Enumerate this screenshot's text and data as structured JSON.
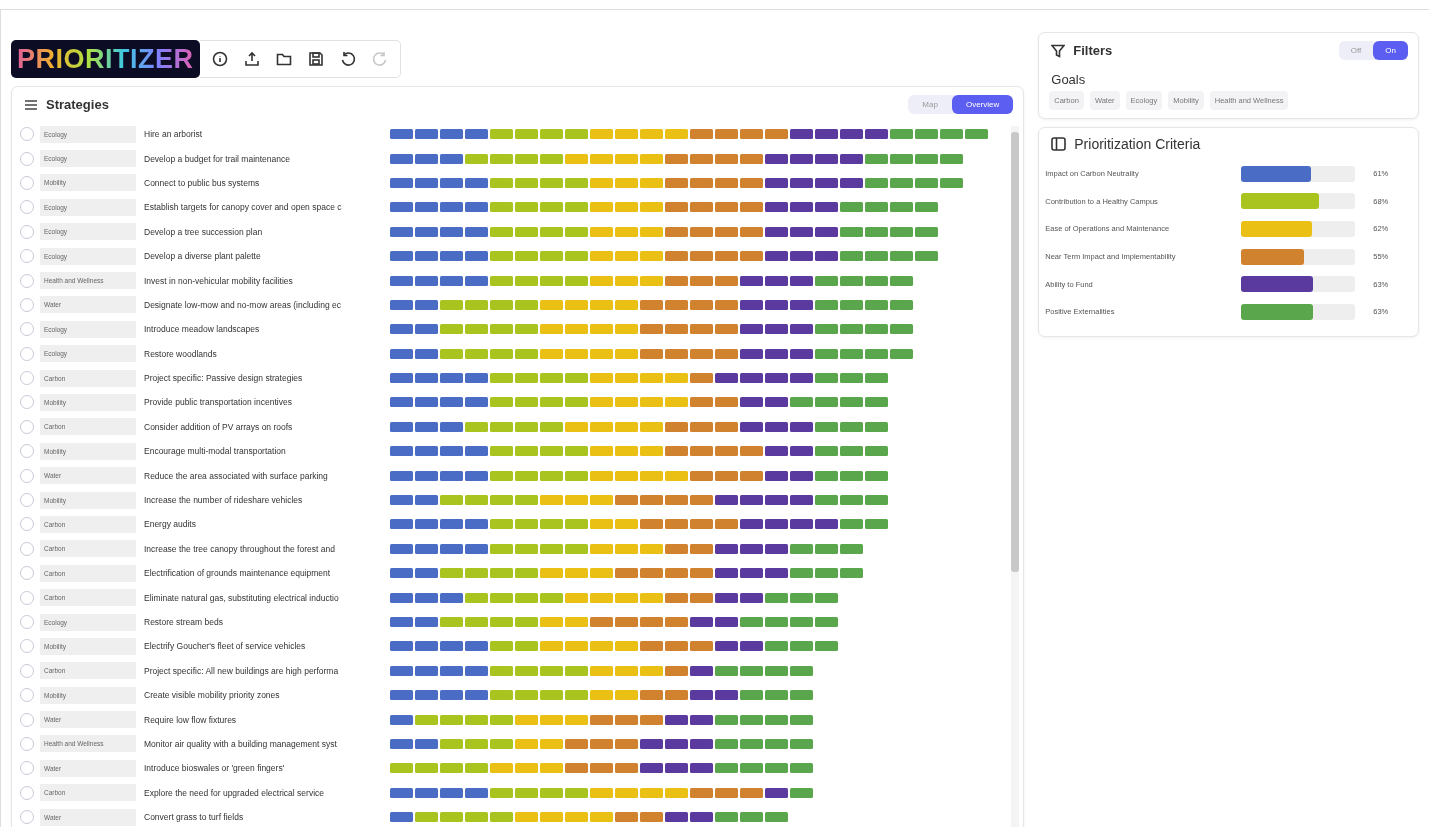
{
  "app": {
    "logo": "PRIORITIZER"
  },
  "toolbar": [
    {
      "kind": "info",
      "disabled": false
    },
    {
      "kind": "upload",
      "disabled": false
    },
    {
      "kind": "folder",
      "disabled": false
    },
    {
      "kind": "save",
      "disabled": false
    },
    {
      "kind": "undo",
      "disabled": false
    },
    {
      "kind": "redo",
      "disabled": true
    }
  ],
  "strategies": {
    "title": "Strategies",
    "views": [
      {
        "label": "Map",
        "selected": false
      },
      {
        "label": "Overview",
        "selected": true
      }
    ],
    "rows": [
      {
        "goal": "Ecology",
        "name": "Hire an arborist",
        "selected": false,
        "blocks": [
          {
            "color": "#4a6cc4"
          },
          {
            "color": "#4a6cc4"
          },
          {
            "color": "#4a6cc4"
          },
          {
            "color": "#4a6cc4"
          },
          {
            "color": "#a9c41f"
          },
          {
            "color": "#a9c41f"
          },
          {
            "color": "#a9c41f"
          },
          {
            "color": "#a9c41f"
          },
          {
            "color": "#e9c013"
          },
          {
            "color": "#e9c013"
          },
          {
            "color": "#e9c013"
          },
          {
            "color": "#e9c013"
          },
          {
            "color": "#d0822f"
          },
          {
            "color": "#d0822f"
          },
          {
            "color": "#d0822f"
          },
          {
            "color": "#d0822f"
          },
          {
            "color": "#5a3a9f"
          },
          {
            "color": "#5a3a9f"
          },
          {
            "color": "#5a3a9f"
          },
          {
            "color": "#5a3a9f"
          },
          {
            "color": "#5aa64c"
          },
          {
            "color": "#5aa64c"
          },
          {
            "color": "#5aa64c"
          },
          {
            "color": "#5aa64c"
          }
        ]
      },
      {
        "goal": "Ecology",
        "name": "Develop a budget for trail maintenance",
        "selected": false,
        "blocks": [
          {
            "color": "#4a6cc4"
          },
          {
            "color": "#4a6cc4"
          },
          {
            "color": "#4a6cc4"
          },
          {
            "color": "#a9c41f"
          },
          {
            "color": "#a9c41f"
          },
          {
            "color": "#a9c41f"
          },
          {
            "color": "#a9c41f"
          },
          {
            "color": "#e9c013"
          },
          {
            "color": "#e9c013"
          },
          {
            "color": "#e9c013"
          },
          {
            "color": "#e9c013"
          },
          {
            "color": "#d0822f"
          },
          {
            "color": "#d0822f"
          },
          {
            "color": "#d0822f"
          },
          {
            "color": "#d0822f"
          },
          {
            "color": "#5a3a9f"
          },
          {
            "color": "#5a3a9f"
          },
          {
            "color": "#5a3a9f"
          },
          {
            "color": "#5a3a9f"
          },
          {
            "color": "#5aa64c"
          },
          {
            "color": "#5aa64c"
          },
          {
            "color": "#5aa64c"
          },
          {
            "color": "#5aa64c"
          }
        ]
      },
      {
        "goal": "Mobility",
        "name": "Connect to public bus systems",
        "selected": false,
        "blocks": [
          {
            "color": "#4a6cc4"
          },
          {
            "color": "#4a6cc4"
          },
          {
            "color": "#4a6cc4"
          },
          {
            "color": "#4a6cc4"
          },
          {
            "color": "#a9c41f"
          },
          {
            "color": "#a9c41f"
          },
          {
            "color": "#a9c41f"
          },
          {
            "color": "#a9c41f"
          },
          {
            "color": "#e9c013"
          },
          {
            "color": "#e9c013"
          },
          {
            "color": "#e9c013"
          },
          {
            "color": "#d0822f"
          },
          {
            "color": "#d0822f"
          },
          {
            "color": "#d0822f"
          },
          {
            "color": "#d0822f"
          },
          {
            "color": "#5a3a9f"
          },
          {
            "color": "#5a3a9f"
          },
          {
            "color": "#5a3a9f"
          },
          {
            "color": "#5a3a9f"
          },
          {
            "color": "#5aa64c"
          },
          {
            "color": "#5aa64c"
          },
          {
            "color": "#5aa64c"
          },
          {
            "color": "#5aa64c"
          }
        ]
      },
      {
        "goal": "Ecology",
        "name": "Establish targets for canopy cover and open space c",
        "selected": false,
        "blocks": [
          {
            "color": "#4a6cc4"
          },
          {
            "color": "#4a6cc4"
          },
          {
            "color": "#4a6cc4"
          },
          {
            "color": "#4a6cc4"
          },
          {
            "color": "#a9c41f"
          },
          {
            "color": "#a9c41f"
          },
          {
            "color": "#a9c41f"
          },
          {
            "color": "#a9c41f"
          },
          {
            "color": "#e9c013"
          },
          {
            "color": "#e9c013"
          },
          {
            "color": "#e9c013"
          },
          {
            "color": "#d0822f"
          },
          {
            "color": "#d0822f"
          },
          {
            "color": "#d0822f"
          },
          {
            "color": "#d0822f"
          },
          {
            "color": "#5a3a9f"
          },
          {
            "color": "#5a3a9f"
          },
          {
            "color": "#5a3a9f"
          },
          {
            "color": "#5aa64c"
          },
          {
            "color": "#5aa64c"
          },
          {
            "color": "#5aa64c"
          },
          {
            "color": "#5aa64c"
          }
        ]
      },
      {
        "goal": "Ecology",
        "name": "Develop a tree succession plan",
        "selected": false,
        "blocks": [
          {
            "color": "#4a6cc4"
          },
          {
            "color": "#4a6cc4"
          },
          {
            "color": "#4a6cc4"
          },
          {
            "color": "#4a6cc4"
          },
          {
            "color": "#a9c41f"
          },
          {
            "color": "#a9c41f"
          },
          {
            "color": "#a9c41f"
          },
          {
            "color": "#a9c41f"
          },
          {
            "color": "#e9c013"
          },
          {
            "color": "#e9c013"
          },
          {
            "color": "#e9c013"
          },
          {
            "color": "#d0822f"
          },
          {
            "color": "#d0822f"
          },
          {
            "color": "#d0822f"
          },
          {
            "color": "#d0822f"
          },
          {
            "color": "#5a3a9f"
          },
          {
            "color": "#5a3a9f"
          },
          {
            "color": "#5a3a9f"
          },
          {
            "color": "#5aa64c"
          },
          {
            "color": "#5aa64c"
          },
          {
            "color": "#5aa64c"
          },
          {
            "color": "#5aa64c"
          }
        ]
      },
      {
        "goal": "Ecology",
        "name": "Develop a diverse plant palette",
        "selected": false,
        "blocks": [
          {
            "color": "#4a6cc4"
          },
          {
            "color": "#4a6cc4"
          },
          {
            "color": "#4a6cc4"
          },
          {
            "color": "#4a6cc4"
          },
          {
            "color": "#a9c41f"
          },
          {
            "color": "#a9c41f"
          },
          {
            "color": "#a9c41f"
          },
          {
            "color": "#a9c41f"
          },
          {
            "color": "#e9c013"
          },
          {
            "color": "#e9c013"
          },
          {
            "color": "#e9c013"
          },
          {
            "color": "#d0822f"
          },
          {
            "color": "#d0822f"
          },
          {
            "color": "#d0822f"
          },
          {
            "color": "#d0822f"
          },
          {
            "color": "#5a3a9f"
          },
          {
            "color": "#5a3a9f"
          },
          {
            "color": "#5a3a9f"
          },
          {
            "color": "#5aa64c"
          },
          {
            "color": "#5aa64c"
          },
          {
            "color": "#5aa64c"
          },
          {
            "color": "#5aa64c"
          }
        ]
      },
      {
        "goal": "Health and Wellness",
        "name": "Invest in non-vehicular mobility facilities",
        "selected": false,
        "blocks": [
          {
            "color": "#4a6cc4"
          },
          {
            "color": "#4a6cc4"
          },
          {
            "color": "#4a6cc4"
          },
          {
            "color": "#4a6cc4"
          },
          {
            "color": "#a9c41f"
          },
          {
            "color": "#a9c41f"
          },
          {
            "color": "#a9c41f"
          },
          {
            "color": "#a9c41f"
          },
          {
            "color": "#e9c013"
          },
          {
            "color": "#e9c013"
          },
          {
            "color": "#e9c013"
          },
          {
            "color": "#d0822f"
          },
          {
            "color": "#d0822f"
          },
          {
            "color": "#d0822f"
          },
          {
            "color": "#5a3a9f"
          },
          {
            "color": "#5a3a9f"
          },
          {
            "color": "#5a3a9f"
          },
          {
            "color": "#5aa64c"
          },
          {
            "color": "#5aa64c"
          },
          {
            "color": "#5aa64c"
          },
          {
            "color": "#5aa64c"
          }
        ]
      },
      {
        "goal": "Water",
        "name": "Designate low-mow and no-mow areas (including ec",
        "selected": false,
        "blocks": [
          {
            "color": "#4a6cc4"
          },
          {
            "color": "#4a6cc4"
          },
          {
            "color": "#a9c41f"
          },
          {
            "color": "#a9c41f"
          },
          {
            "color": "#a9c41f"
          },
          {
            "color": "#a9c41f"
          },
          {
            "color": "#e9c013"
          },
          {
            "color": "#e9c013"
          },
          {
            "color": "#e9c013"
          },
          {
            "color": "#e9c013"
          },
          {
            "color": "#d0822f"
          },
          {
            "color": "#d0822f"
          },
          {
            "color": "#d0822f"
          },
          {
            "color": "#d0822f"
          },
          {
            "color": "#5a3a9f"
          },
          {
            "color": "#5a3a9f"
          },
          {
            "color": "#5a3a9f"
          },
          {
            "color": "#5aa64c"
          },
          {
            "color": "#5aa64c"
          },
          {
            "color": "#5aa64c"
          },
          {
            "color": "#5aa64c"
          }
        ]
      },
      {
        "goal": "Ecology",
        "name": "Introduce meadow landscapes",
        "selected": false,
        "blocks": [
          {
            "color": "#4a6cc4"
          },
          {
            "color": "#4a6cc4"
          },
          {
            "color": "#a9c41f"
          },
          {
            "color": "#a9c41f"
          },
          {
            "color": "#a9c41f"
          },
          {
            "color": "#a9c41f"
          },
          {
            "color": "#e9c013"
          },
          {
            "color": "#e9c013"
          },
          {
            "color": "#e9c013"
          },
          {
            "color": "#e9c013"
          },
          {
            "color": "#d0822f"
          },
          {
            "color": "#d0822f"
          },
          {
            "color": "#d0822f"
          },
          {
            "color": "#d0822f"
          },
          {
            "color": "#5a3a9f"
          },
          {
            "color": "#5a3a9f"
          },
          {
            "color": "#5a3a9f"
          },
          {
            "color": "#5aa64c"
          },
          {
            "color": "#5aa64c"
          },
          {
            "color": "#5aa64c"
          },
          {
            "color": "#5aa64c"
          }
        ]
      },
      {
        "goal": "Ecology",
        "name": "Restore woodlands",
        "selected": false,
        "blocks": [
          {
            "color": "#4a6cc4"
          },
          {
            "color": "#4a6cc4"
          },
          {
            "color": "#a9c41f"
          },
          {
            "color": "#a9c41f"
          },
          {
            "color": "#a9c41f"
          },
          {
            "color": "#a9c41f"
          },
          {
            "color": "#e9c013"
          },
          {
            "color": "#e9c013"
          },
          {
            "color": "#e9c013"
          },
          {
            "color": "#e9c013"
          },
          {
            "color": "#d0822f"
          },
          {
            "color": "#d0822f"
          },
          {
            "color": "#d0822f"
          },
          {
            "color": "#d0822f"
          },
          {
            "color": "#5a3a9f"
          },
          {
            "color": "#5a3a9f"
          },
          {
            "color": "#5a3a9f"
          },
          {
            "color": "#5aa64c"
          },
          {
            "color": "#5aa64c"
          },
          {
            "color": "#5aa64c"
          },
          {
            "color": "#5aa64c"
          }
        ]
      },
      {
        "goal": "Carbon",
        "name": "Project specific: Passive design strategies",
        "selected": false,
        "blocks": [
          {
            "color": "#4a6cc4"
          },
          {
            "color": "#4a6cc4"
          },
          {
            "color": "#4a6cc4"
          },
          {
            "color": "#4a6cc4"
          },
          {
            "color": "#a9c41f"
          },
          {
            "color": "#a9c41f"
          },
          {
            "color": "#a9c41f"
          },
          {
            "color": "#a9c41f"
          },
          {
            "color": "#e9c013"
          },
          {
            "color": "#e9c013"
          },
          {
            "color": "#e9c013"
          },
          {
            "color": "#e9c013"
          },
          {
            "color": "#d0822f"
          },
          {
            "color": "#5a3a9f"
          },
          {
            "color": "#5a3a9f"
          },
          {
            "color": "#5a3a9f"
          },
          {
            "color": "#5a3a9f"
          },
          {
            "color": "#5aa64c"
          },
          {
            "color": "#5aa64c"
          },
          {
            "color": "#5aa64c"
          }
        ]
      },
      {
        "goal": "Mobility",
        "name": "Provide public transportation incentives",
        "selected": false,
        "blocks": [
          {
            "color": "#4a6cc4"
          },
          {
            "color": "#4a6cc4"
          },
          {
            "color": "#4a6cc4"
          },
          {
            "color": "#4a6cc4"
          },
          {
            "color": "#a9c41f"
          },
          {
            "color": "#a9c41f"
          },
          {
            "color": "#a9c41f"
          },
          {
            "color": "#a9c41f"
          },
          {
            "color": "#e9c013"
          },
          {
            "color": "#e9c013"
          },
          {
            "color": "#e9c013"
          },
          {
            "color": "#e9c013"
          },
          {
            "color": "#d0822f"
          },
          {
            "color": "#d0822f"
          },
          {
            "color": "#5a3a9f"
          },
          {
            "color": "#5a3a9f"
          },
          {
            "color": "#5aa64c"
          },
          {
            "color": "#5aa64c"
          },
          {
            "color": "#5aa64c"
          },
          {
            "color": "#5aa64c"
          }
        ]
      },
      {
        "goal": "Carbon",
        "name": "Consider addition of PV arrays on roofs",
        "selected": false,
        "blocks": [
          {
            "color": "#4a6cc4"
          },
          {
            "color": "#4a6cc4"
          },
          {
            "color": "#4a6cc4"
          },
          {
            "color": "#a9c41f"
          },
          {
            "color": "#a9c41f"
          },
          {
            "color": "#a9c41f"
          },
          {
            "color": "#a9c41f"
          },
          {
            "color": "#e9c013"
          },
          {
            "color": "#e9c013"
          },
          {
            "color": "#e9c013"
          },
          {
            "color": "#e9c013"
          },
          {
            "color": "#d0822f"
          },
          {
            "color": "#d0822f"
          },
          {
            "color": "#d0822f"
          },
          {
            "color": "#5a3a9f"
          },
          {
            "color": "#5a3a9f"
          },
          {
            "color": "#5a3a9f"
          },
          {
            "color": "#5aa64c"
          },
          {
            "color": "#5aa64c"
          },
          {
            "color": "#5aa64c"
          }
        ]
      },
      {
        "goal": "Mobility",
        "name": "Encourage multi-modal transportation",
        "selected": false,
        "blocks": [
          {
            "color": "#4a6cc4"
          },
          {
            "color": "#4a6cc4"
          },
          {
            "color": "#4a6cc4"
          },
          {
            "color": "#4a6cc4"
          },
          {
            "color": "#a9c41f"
          },
          {
            "color": "#a9c41f"
          },
          {
            "color": "#a9c41f"
          },
          {
            "color": "#a9c41f"
          },
          {
            "color": "#e9c013"
          },
          {
            "color": "#e9c013"
          },
          {
            "color": "#e9c013"
          },
          {
            "color": "#d0822f"
          },
          {
            "color": "#d0822f"
          },
          {
            "color": "#d0822f"
          },
          {
            "color": "#d0822f"
          },
          {
            "color": "#5a3a9f"
          },
          {
            "color": "#5a3a9f"
          },
          {
            "color": "#5aa64c"
          },
          {
            "color": "#5aa64c"
          },
          {
            "color": "#5aa64c"
          }
        ]
      },
      {
        "goal": "Water",
        "name": "Reduce the area associated with surface parking",
        "selected": false,
        "blocks": [
          {
            "color": "#4a6cc4"
          },
          {
            "color": "#4a6cc4"
          },
          {
            "color": "#4a6cc4"
          },
          {
            "color": "#4a6cc4"
          },
          {
            "color": "#a9c41f"
          },
          {
            "color": "#a9c41f"
          },
          {
            "color": "#a9c41f"
          },
          {
            "color": "#a9c41f"
          },
          {
            "color": "#e9c013"
          },
          {
            "color": "#e9c013"
          },
          {
            "color": "#e9c013"
          },
          {
            "color": "#e9c013"
          },
          {
            "color": "#d0822f"
          },
          {
            "color": "#d0822f"
          },
          {
            "color": "#d0822f"
          },
          {
            "color": "#5a3a9f"
          },
          {
            "color": "#5a3a9f"
          },
          {
            "color": "#5aa64c"
          },
          {
            "color": "#5aa64c"
          },
          {
            "color": "#5aa64c"
          }
        ]
      },
      {
        "goal": "Mobility",
        "name": "Increase the number of rideshare vehicles",
        "selected": false,
        "blocks": [
          {
            "color": "#4a6cc4"
          },
          {
            "color": "#4a6cc4"
          },
          {
            "color": "#a9c41f"
          },
          {
            "color": "#a9c41f"
          },
          {
            "color": "#a9c41f"
          },
          {
            "color": "#a9c41f"
          },
          {
            "color": "#e9c013"
          },
          {
            "color": "#e9c013"
          },
          {
            "color": "#e9c013"
          },
          {
            "color": "#d0822f"
          },
          {
            "color": "#d0822f"
          },
          {
            "color": "#d0822f"
          },
          {
            "color": "#d0822f"
          },
          {
            "color": "#5a3a9f"
          },
          {
            "color": "#5a3a9f"
          },
          {
            "color": "#5a3a9f"
          },
          {
            "color": "#5a3a9f"
          },
          {
            "color": "#5aa64c"
          },
          {
            "color": "#5aa64c"
          },
          {
            "color": "#5aa64c"
          }
        ]
      },
      {
        "goal": "Carbon",
        "name": "Energy audits",
        "selected": false,
        "blocks": [
          {
            "color": "#4a6cc4"
          },
          {
            "color": "#4a6cc4"
          },
          {
            "color": "#4a6cc4"
          },
          {
            "color": "#4a6cc4"
          },
          {
            "color": "#a9c41f"
          },
          {
            "color": "#a9c41f"
          },
          {
            "color": "#a9c41f"
          },
          {
            "color": "#a9c41f"
          },
          {
            "color": "#e9c013"
          },
          {
            "color": "#e9c013"
          },
          {
            "color": "#d0822f"
          },
          {
            "color": "#d0822f"
          },
          {
            "color": "#d0822f"
          },
          {
            "color": "#d0822f"
          },
          {
            "color": "#5a3a9f"
          },
          {
            "color": "#5a3a9f"
          },
          {
            "color": "#5a3a9f"
          },
          {
            "color": "#5a3a9f"
          },
          {
            "color": "#5aa64c"
          },
          {
            "color": "#5aa64c"
          }
        ]
      },
      {
        "goal": "Carbon",
        "name": "Increase the tree canopy throughout the forest and",
        "selected": false,
        "blocks": [
          {
            "color": "#4a6cc4"
          },
          {
            "color": "#4a6cc4"
          },
          {
            "color": "#4a6cc4"
          },
          {
            "color": "#4a6cc4"
          },
          {
            "color": "#a9c41f"
          },
          {
            "color": "#a9c41f"
          },
          {
            "color": "#a9c41f"
          },
          {
            "color": "#a9c41f"
          },
          {
            "color": "#e9c013"
          },
          {
            "color": "#e9c013"
          },
          {
            "color": "#e9c013"
          },
          {
            "color": "#d0822f"
          },
          {
            "color": "#d0822f"
          },
          {
            "color": "#5a3a9f"
          },
          {
            "color": "#5a3a9f"
          },
          {
            "color": "#5a3a9f"
          },
          {
            "color": "#5aa64c"
          },
          {
            "color": "#5aa64c"
          },
          {
            "color": "#5aa64c"
          }
        ]
      },
      {
        "goal": "Carbon",
        "name": "Electrification of grounds maintenance equipment",
        "selected": false,
        "blocks": [
          {
            "color": "#4a6cc4"
          },
          {
            "color": "#4a6cc4"
          },
          {
            "color": "#a9c41f"
          },
          {
            "color": "#a9c41f"
          },
          {
            "color": "#a9c41f"
          },
          {
            "color": "#a9c41f"
          },
          {
            "color": "#e9c013"
          },
          {
            "color": "#e9c013"
          },
          {
            "color": "#e9c013"
          },
          {
            "color": "#d0822f"
          },
          {
            "color": "#d0822f"
          },
          {
            "color": "#d0822f"
          },
          {
            "color": "#d0822f"
          },
          {
            "color": "#5a3a9f"
          },
          {
            "color": "#5a3a9f"
          },
          {
            "color": "#5a3a9f"
          },
          {
            "color": "#5aa64c"
          },
          {
            "color": "#5aa64c"
          },
          {
            "color": "#5aa64c"
          }
        ]
      },
      {
        "goal": "Carbon",
        "name": "Eliminate natural gas, substituting electrical inductio",
        "selected": false,
        "blocks": [
          {
            "color": "#4a6cc4"
          },
          {
            "color": "#4a6cc4"
          },
          {
            "color": "#4a6cc4"
          },
          {
            "color": "#a9c41f"
          },
          {
            "color": "#a9c41f"
          },
          {
            "color": "#a9c41f"
          },
          {
            "color": "#a9c41f"
          },
          {
            "color": "#e9c013"
          },
          {
            "color": "#e9c013"
          },
          {
            "color": "#e9c013"
          },
          {
            "color": "#e9c013"
          },
          {
            "color": "#d0822f"
          },
          {
            "color": "#d0822f"
          },
          {
            "color": "#5a3a9f"
          },
          {
            "color": "#5a3a9f"
          },
          {
            "color": "#5aa64c"
          },
          {
            "color": "#5aa64c"
          },
          {
            "color": "#5aa64c"
          }
        ]
      },
      {
        "goal": "Ecology",
        "name": "Restore stream beds",
        "selected": false,
        "blocks": [
          {
            "color": "#4a6cc4"
          },
          {
            "color": "#4a6cc4"
          },
          {
            "color": "#a9c41f"
          },
          {
            "color": "#a9c41f"
          },
          {
            "color": "#a9c41f"
          },
          {
            "color": "#a9c41f"
          },
          {
            "color": "#e9c013"
          },
          {
            "color": "#e9c013"
          },
          {
            "color": "#d0822f"
          },
          {
            "color": "#d0822f"
          },
          {
            "color": "#d0822f"
          },
          {
            "color": "#d0822f"
          },
          {
            "color": "#5a3a9f"
          },
          {
            "color": "#5a3a9f"
          },
          {
            "color": "#5aa64c"
          },
          {
            "color": "#5aa64c"
          },
          {
            "color": "#5aa64c"
          },
          {
            "color": "#5aa64c"
          }
        ]
      },
      {
        "goal": "Mobility",
        "name": "Electrify Goucher's fleet of service vehicles",
        "selected": false,
        "blocks": [
          {
            "color": "#4a6cc4"
          },
          {
            "color": "#4a6cc4"
          },
          {
            "color": "#4a6cc4"
          },
          {
            "color": "#4a6cc4"
          },
          {
            "color": "#a9c41f"
          },
          {
            "color": "#a9c41f"
          },
          {
            "color": "#e9c013"
          },
          {
            "color": "#e9c013"
          },
          {
            "color": "#e9c013"
          },
          {
            "color": "#e9c013"
          },
          {
            "color": "#d0822f"
          },
          {
            "color": "#d0822f"
          },
          {
            "color": "#d0822f"
          },
          {
            "color": "#5a3a9f"
          },
          {
            "color": "#5a3a9f"
          },
          {
            "color": "#5aa64c"
          },
          {
            "color": "#5aa64c"
          },
          {
            "color": "#5aa64c"
          }
        ]
      },
      {
        "goal": "Carbon",
        "name": "Project specific: All new buildings are high performa",
        "selected": false,
        "blocks": [
          {
            "color": "#4a6cc4"
          },
          {
            "color": "#4a6cc4"
          },
          {
            "color": "#4a6cc4"
          },
          {
            "color": "#4a6cc4"
          },
          {
            "color": "#a9c41f"
          },
          {
            "color": "#a9c41f"
          },
          {
            "color": "#a9c41f"
          },
          {
            "color": "#a9c41f"
          },
          {
            "color": "#e9c013"
          },
          {
            "color": "#e9c013"
          },
          {
            "color": "#e9c013"
          },
          {
            "color": "#d0822f"
          },
          {
            "color": "#5a3a9f"
          },
          {
            "color": "#5aa64c"
          },
          {
            "color": "#5aa64c"
          },
          {
            "color": "#5aa64c"
          },
          {
            "color": "#5aa64c"
          }
        ]
      },
      {
        "goal": "Mobility",
        "name": "Create visible mobility priority zones",
        "selected": false,
        "blocks": [
          {
            "color": "#4a6cc4"
          },
          {
            "color": "#4a6cc4"
          },
          {
            "color": "#4a6cc4"
          },
          {
            "color": "#4a6cc4"
          },
          {
            "color": "#a9c41f"
          },
          {
            "color": "#a9c41f"
          },
          {
            "color": "#a9c41f"
          },
          {
            "color": "#a9c41f"
          },
          {
            "color": "#e9c013"
          },
          {
            "color": "#e9c013"
          },
          {
            "color": "#d0822f"
          },
          {
            "color": "#d0822f"
          },
          {
            "color": "#5a3a9f"
          },
          {
            "color": "#5a3a9f"
          },
          {
            "color": "#5aa64c"
          },
          {
            "color": "#5aa64c"
          },
          {
            "color": "#5aa64c"
          }
        ]
      },
      {
        "goal": "Water",
        "name": "Require low flow fixtures",
        "selected": false,
        "blocks": [
          {
            "color": "#4a6cc4"
          },
          {
            "color": "#a9c41f"
          },
          {
            "color": "#a9c41f"
          },
          {
            "color": "#a9c41f"
          },
          {
            "color": "#a9c41f"
          },
          {
            "color": "#e9c013"
          },
          {
            "color": "#e9c013"
          },
          {
            "color": "#e9c013"
          },
          {
            "color": "#d0822f"
          },
          {
            "color": "#d0822f"
          },
          {
            "color": "#d0822f"
          },
          {
            "color": "#5a3a9f"
          },
          {
            "color": "#5a3a9f"
          },
          {
            "color": "#5aa64c"
          },
          {
            "color": "#5aa64c"
          },
          {
            "color": "#5aa64c"
          },
          {
            "color": "#5aa64c"
          }
        ]
      },
      {
        "goal": "Health and Wellness",
        "name": "Monitor air quality with a building management syst",
        "selected": false,
        "blocks": [
          {
            "color": "#4a6cc4"
          },
          {
            "color": "#4a6cc4"
          },
          {
            "color": "#a9c41f"
          },
          {
            "color": "#a9c41f"
          },
          {
            "color": "#a9c41f"
          },
          {
            "color": "#e9c013"
          },
          {
            "color": "#e9c013"
          },
          {
            "color": "#d0822f"
          },
          {
            "color": "#d0822f"
          },
          {
            "color": "#d0822f"
          },
          {
            "color": "#5a3a9f"
          },
          {
            "color": "#5a3a9f"
          },
          {
            "color": "#5a3a9f"
          },
          {
            "color": "#5aa64c"
          },
          {
            "color": "#5aa64c"
          },
          {
            "color": "#5aa64c"
          },
          {
            "color": "#5aa64c"
          }
        ]
      },
      {
        "goal": "Water",
        "name": "Introduce bioswales or 'green fingers'",
        "selected": false,
        "blocks": [
          {
            "color": "#a9c41f"
          },
          {
            "color": "#a9c41f"
          },
          {
            "color": "#a9c41f"
          },
          {
            "color": "#a9c41f"
          },
          {
            "color": "#e9c013"
          },
          {
            "color": "#e9c013"
          },
          {
            "color": "#e9c013"
          },
          {
            "color": "#d0822f"
          },
          {
            "color": "#d0822f"
          },
          {
            "color": "#d0822f"
          },
          {
            "color": "#5a3a9f"
          },
          {
            "color": "#5a3a9f"
          },
          {
            "color": "#5a3a9f"
          },
          {
            "color": "#5aa64c"
          },
          {
            "color": "#5aa64c"
          },
          {
            "color": "#5aa64c"
          },
          {
            "color": "#5aa64c"
          }
        ]
      },
      {
        "goal": "Carbon",
        "name": "Explore the need for upgraded electrical service",
        "selected": false,
        "blocks": [
          {
            "color": "#4a6cc4"
          },
          {
            "color": "#4a6cc4"
          },
          {
            "color": "#4a6cc4"
          },
          {
            "color": "#4a6cc4"
          },
          {
            "color": "#a9c41f"
          },
          {
            "color": "#a9c41f"
          },
          {
            "color": "#a9c41f"
          },
          {
            "color": "#a9c41f"
          },
          {
            "color": "#e9c013"
          },
          {
            "color": "#e9c013"
          },
          {
            "color": "#e9c013"
          },
          {
            "color": "#e9c013"
          },
          {
            "color": "#d0822f"
          },
          {
            "color": "#d0822f"
          },
          {
            "color": "#d0822f"
          },
          {
            "color": "#5a3a9f"
          },
          {
            "color": "#5aa64c"
          }
        ]
      },
      {
        "goal": "Water",
        "name": "Convert grass to turf fields",
        "selected": false,
        "blocks": [
          {
            "color": "#4a6cc4"
          },
          {
            "color": "#a9c41f"
          },
          {
            "color": "#a9c41f"
          },
          {
            "color": "#a9c41f"
          },
          {
            "color": "#a9c41f"
          },
          {
            "color": "#e9c013"
          },
          {
            "color": "#e9c013"
          },
          {
            "color": "#e9c013"
          },
          {
            "color": "#e9c013"
          },
          {
            "color": "#d0822f"
          },
          {
            "color": "#d0822f"
          },
          {
            "color": "#5a3a9f"
          },
          {
            "color": "#5a3a9f"
          },
          {
            "color": "#5aa64c"
          },
          {
            "color": "#5aa64c"
          },
          {
            "color": "#5aa64c"
          }
        ]
      }
    ]
  },
  "filters": {
    "title": "Filters",
    "toggle": [
      {
        "label": "Off",
        "selected": false
      },
      {
        "label": "On",
        "selected": true
      }
    ],
    "goals_label": "Goals",
    "goals": [
      {
        "label": "Carbon",
        "selected": false
      },
      {
        "label": "Water",
        "selected": false
      },
      {
        "label": "Ecology",
        "selected": false
      },
      {
        "label": "Mobility",
        "selected": false
      },
      {
        "label": "Health and Wellness",
        "selected": false
      }
    ]
  },
  "criteria": {
    "title": "Prioritization Criteria",
    "items": [
      {
        "label": "Impact on Carbon Neutrality",
        "color": "#4a6cc4",
        "level": 0.61,
        "percent": "61%"
      },
      {
        "label": "Contribution to a Healthy Campus",
        "color": "#a9c41f",
        "level": 0.68,
        "percent": "68%"
      },
      {
        "label": "Ease of Operations and Maintenance",
        "color": "#e9c013",
        "level": 0.62,
        "percent": "62%"
      },
      {
        "label": "Near Term Impact and Implementability",
        "color": "#d0822f",
        "level": 0.55,
        "percent": "55%"
      },
      {
        "label": "Ability to Fund",
        "color": "#5a3a9f",
        "level": 0.63,
        "percent": "63%"
      },
      {
        "label": "Positive Externalities",
        "color": "#5aa64c",
        "level": 0.63,
        "percent": "63%"
      }
    ]
  }
}
